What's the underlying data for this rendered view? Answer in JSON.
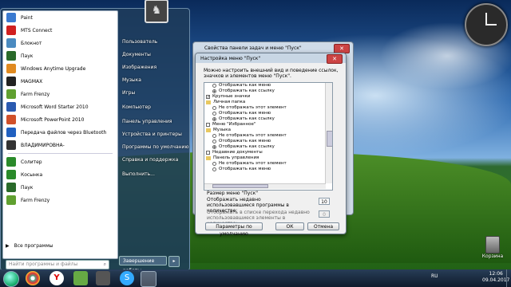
{
  "start_menu": {
    "programs": [
      {
        "label": "Paint",
        "icon": "paint-icon",
        "color": "#3a7ad0"
      },
      {
        "label": "MTS Connect",
        "icon": "mts-icon",
        "color": "#d02020"
      },
      {
        "label": "Блокнот",
        "icon": "notepad-icon",
        "color": "#4a8ac0"
      },
      {
        "label": "Паук",
        "icon": "spider-icon",
        "color": "#2a6a2a"
      },
      {
        "label": "Windows Anytime Upgrade",
        "icon": "windows-icon",
        "color": "#e08a20"
      },
      {
        "label": "MAGMAX",
        "icon": "magmax-icon",
        "color": "#222222"
      },
      {
        "label": "Farm Frenzy",
        "icon": "farm-icon",
        "color": "#60a030"
      },
      {
        "label": "Microsoft Word Starter 2010",
        "icon": "word-icon",
        "color": "#2a5ab0"
      },
      {
        "label": "Microsoft PowerPoint 2010",
        "icon": "powerpoint-icon",
        "color": "#d0502a"
      },
      {
        "label": "Передача файлов через Bluetooth",
        "icon": "bluetooth-icon",
        "color": "#2060c0"
      },
      {
        "label": "ВЛАДИМИРОВНА-",
        "icon": "user-folder-icon",
        "color": "#333333"
      },
      {
        "label": "Солитер",
        "icon": "solitaire-icon",
        "color": "#2a8a2a"
      },
      {
        "label": "Косынка",
        "icon": "klondike-icon",
        "color": "#2a8a2a"
      },
      {
        "label": "Паук",
        "icon": "spider-icon",
        "color": "#2a6a2a"
      },
      {
        "label": "Farm Frenzy",
        "icon": "farm-icon",
        "color": "#60a030"
      }
    ],
    "all_programs": "Все программы",
    "search_placeholder": "Найти программы и файлы",
    "right_items": [
      "Пользователь",
      "Документы",
      "Изображения",
      "Музыка",
      "Игры",
      "Компьютер",
      "Панель управления",
      "Устройства и принтеры",
      "Программы по умолчанию",
      "Справка и поддержка",
      "Выполнить..."
    ],
    "shutdown": "Завершение работы"
  },
  "background_window": {
    "title": "Свойства панели задач и меню \"Пуск\""
  },
  "dialog": {
    "title": "Настройка меню \"Пуск\"",
    "description": "Можно настроить внешний вид и поведение ссылок, значков и элементов меню \"Пуск\".",
    "tree": [
      {
        "kind": "radio",
        "checked": false,
        "indent": 1,
        "label": "Отображать как меню"
      },
      {
        "kind": "radio",
        "checked": true,
        "indent": 1,
        "label": "Отображать как ссылку"
      },
      {
        "kind": "check",
        "checked": true,
        "indent": 0,
        "label": "Крупные значки"
      },
      {
        "kind": "folder",
        "indent": 0,
        "label": "Личная папка"
      },
      {
        "kind": "radio",
        "checked": false,
        "indent": 1,
        "label": "Не отображать этот элемент"
      },
      {
        "kind": "radio",
        "checked": false,
        "indent": 1,
        "label": "Отображать как меню"
      },
      {
        "kind": "radio",
        "checked": true,
        "indent": 1,
        "label": "Отображать как ссылку"
      },
      {
        "kind": "check",
        "checked": false,
        "indent": 0,
        "label": "Меню \"Избранное\""
      },
      {
        "kind": "folder",
        "indent": 0,
        "label": "Музыка"
      },
      {
        "kind": "radio",
        "checked": false,
        "indent": 1,
        "label": "Не отображать этот элемент"
      },
      {
        "kind": "radio",
        "checked": false,
        "indent": 1,
        "label": "Отображать как меню"
      },
      {
        "kind": "radio",
        "checked": true,
        "indent": 1,
        "label": "Отображать как ссылку"
      },
      {
        "kind": "check",
        "checked": false,
        "indent": 0,
        "label": "Недавние документы"
      },
      {
        "kind": "folder",
        "indent": 0,
        "label": "Панель управления"
      },
      {
        "kind": "radio",
        "checked": false,
        "indent": 1,
        "label": "Не отображать этот элемент"
      },
      {
        "kind": "radio",
        "checked": false,
        "indent": 1,
        "label": "Отображать как меню"
      }
    ],
    "size_label": "Размер меню \"Пуск\"",
    "recent_programs_label": "Отображать недавно использовавшиеся программы в количестве:",
    "recent_programs_value": "10",
    "jump_list_label": "Отображать в списке перехода недавно использовавшиеся элементы в количестве:",
    "jump_list_value": "0",
    "default_button": "Параметры по умолчанию",
    "ok_button": "ОК",
    "cancel_button": "Отмена"
  },
  "desktop": {
    "recycle_bin": "Корзина"
  },
  "taskbar": {
    "language": "RU",
    "time": "12:06",
    "date": "09.04.2017"
  }
}
